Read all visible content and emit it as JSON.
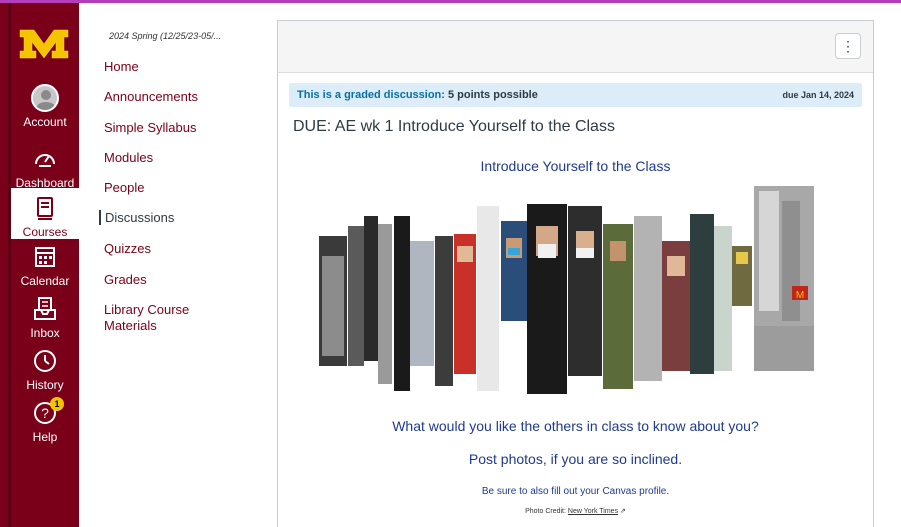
{
  "global_nav": {
    "items": [
      {
        "label": "Account",
        "icon": "account-avatar-icon"
      },
      {
        "label": "Dashboard",
        "icon": "dashboard-gauge-icon"
      },
      {
        "label": "Courses",
        "icon": "courses-book-icon",
        "active": true
      },
      {
        "label": "Calendar",
        "icon": "calendar-icon"
      },
      {
        "label": "Inbox",
        "icon": "inbox-icon"
      },
      {
        "label": "History",
        "icon": "clock-icon"
      },
      {
        "label": "Help",
        "icon": "help-question-icon",
        "badge": "1"
      }
    ],
    "colors": {
      "brand": "#7a0019",
      "gold": "#f5c400"
    }
  },
  "course_nav": {
    "term": "2024 Spring (12/25/23-05/...",
    "items": [
      {
        "label": "Home"
      },
      {
        "label": "Announcements"
      },
      {
        "label": "Simple Syllabus"
      },
      {
        "label": "Modules"
      },
      {
        "label": "People"
      },
      {
        "label": "Discussions",
        "active": true
      },
      {
        "label": "Quizzes"
      },
      {
        "label": "Grades"
      },
      {
        "label": "Library Course Materials"
      }
    ]
  },
  "discussion": {
    "graded_label": "This is a graded discussion:",
    "points": "5 points possible",
    "due": "due Jan 14, 2024",
    "title": "DUE: AE wk 1 Introduce Yourself to the Class",
    "intro_title": "Introduce Yourself to the Class",
    "question": "What would you like the others in class to know about you?",
    "photos": "Post photos, if you are so inclined.",
    "profile": "Be sure to also fill out your Canvas profile.",
    "credit_prefix": "Photo Credit:",
    "credit_link": "New York Times"
  },
  "toolbar": {
    "menu_icon": "kebab-menu-icon"
  }
}
